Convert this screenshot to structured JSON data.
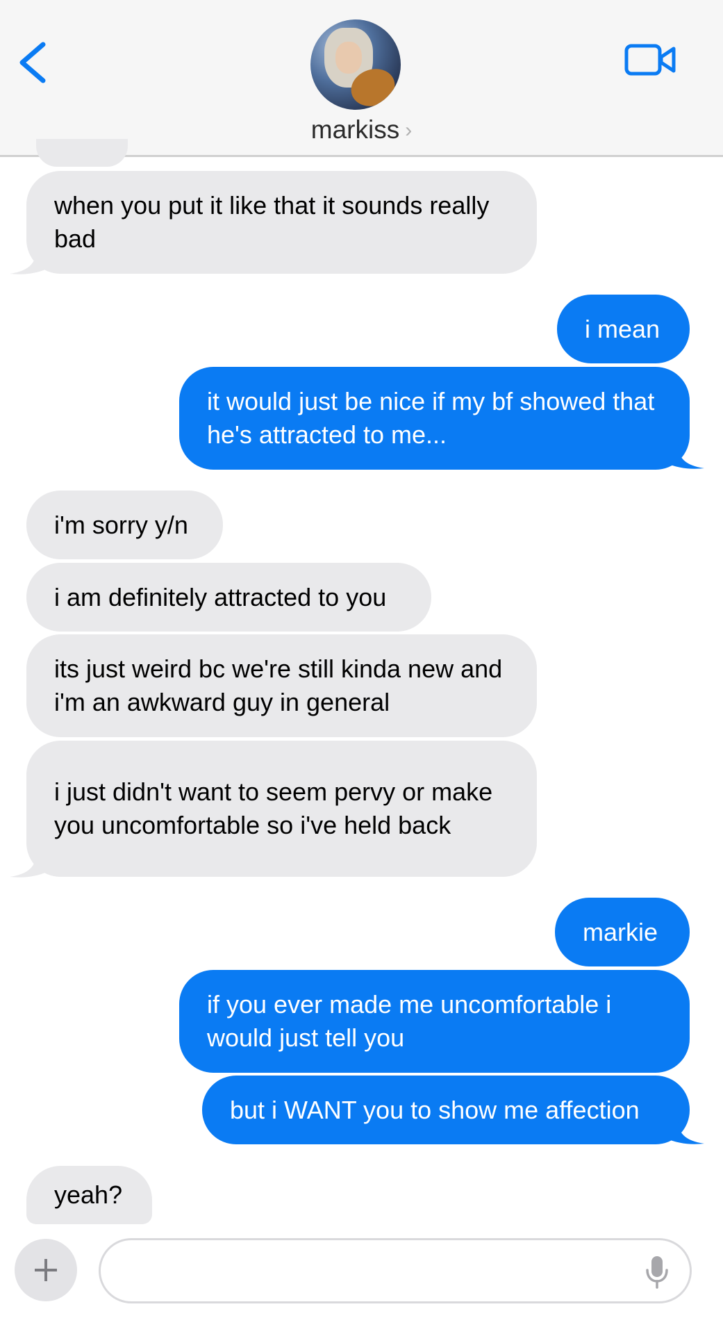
{
  "header": {
    "contact_name": "markiss",
    "colors": {
      "header_bg": "#f6f6f6",
      "accent": "#0a7bf3"
    },
    "icons": {
      "back": "chevron-left-icon",
      "video": "video-camera-icon",
      "disclosure": "chevron-right-icon"
    }
  },
  "messages": [
    {
      "from": "them",
      "text": "when you put it like that it sounds really bad"
    },
    {
      "from": "me",
      "text": "i mean"
    },
    {
      "from": "me",
      "text": "it would just be nice if my bf showed that he's attracted to me..."
    },
    {
      "from": "them",
      "text": "i'm sorry y/n"
    },
    {
      "from": "them",
      "text": "i am definitely attracted to you"
    },
    {
      "from": "them",
      "text": "its just weird bc we're still kinda new and i'm an awkward guy in general"
    },
    {
      "from": "them",
      "text": "i just didn't want to seem pervy or make you uncomfortable so i've held back"
    },
    {
      "from": "me",
      "text": "markie"
    },
    {
      "from": "me",
      "text": "if you ever made me uncomfortable i would just tell you"
    },
    {
      "from": "me",
      "text": "but i WANT you to show me affection"
    },
    {
      "from": "them",
      "text": "yeah?"
    }
  ],
  "composer": {
    "value": "",
    "plus_icon": "plus-icon",
    "mic_icon": "microphone-icon"
  },
  "colors": {
    "received_bubble": "#e9e9eb",
    "sent_bubble": "#0a7bf3"
  }
}
